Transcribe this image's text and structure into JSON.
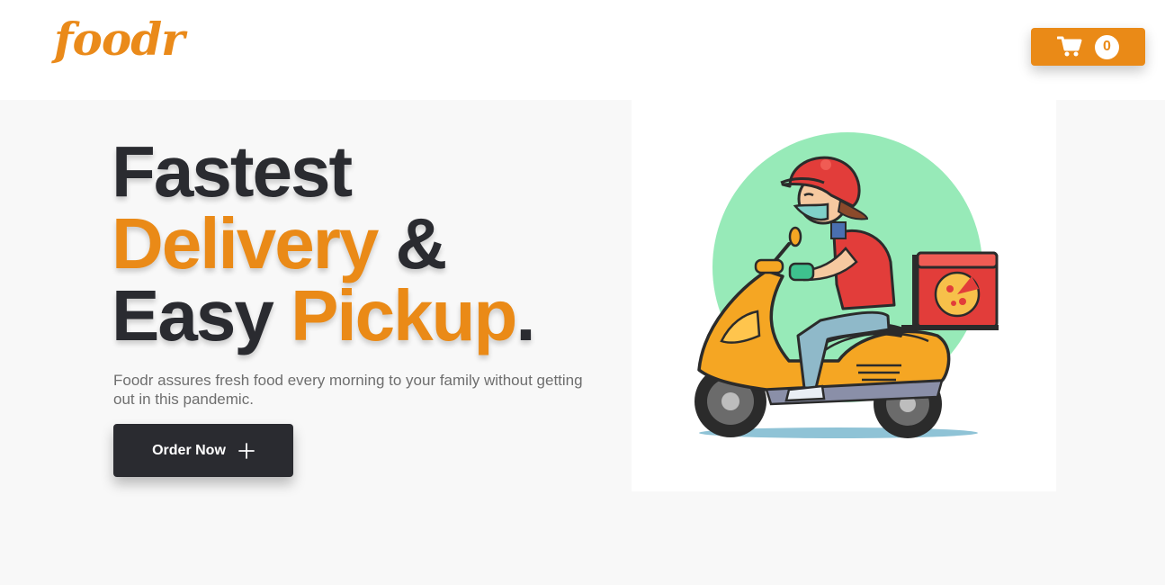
{
  "header": {
    "logo_text": "foodr",
    "cart": {
      "icon": "shopping-cart-icon",
      "count": "0"
    }
  },
  "hero": {
    "headline": {
      "line1": "Fastest",
      "line2_accent": "Delivery",
      "line2_rest": " &",
      "line3_start": "Easy ",
      "line3_accent": "Pickup",
      "line3_end": "."
    },
    "description": "Foodr assures fresh food every morning to your family without getting out in this pandemic.",
    "order_button": {
      "label": "Order Now",
      "icon": "plus-icon"
    },
    "illustration": {
      "subject": "delivery-scooter-rider-illustration"
    }
  },
  "colors": {
    "accent": "#ea8a17",
    "dark": "#2a2b30",
    "background": "#f8f8f8",
    "mint_circle": "#97eab8"
  }
}
